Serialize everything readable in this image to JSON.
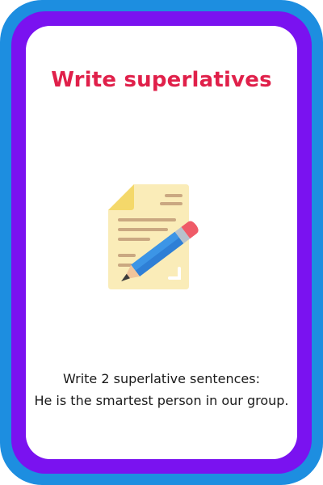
{
  "card": {
    "title": "Write superlatives",
    "instruction_line1": "Write 2 superlative sentences:",
    "instruction_line2": "He is the smartest person in our group.",
    "illustration_icon": "document-with-pencil-icon"
  },
  "colors": {
    "title": "#e0204a",
    "outer_frame": "#1d8ee0",
    "inner_frame": "#7a12f0",
    "card_background": "#ffffff"
  }
}
